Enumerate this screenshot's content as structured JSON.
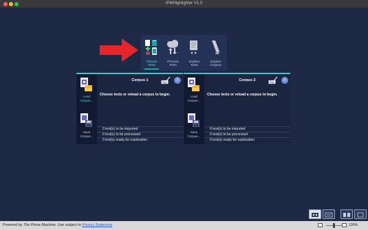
{
  "window": {
    "title": "tPMHighlighter V1.0"
  },
  "toolbar": {
    "items": [
      {
        "label_l1": "Choose",
        "label_l2": "Texts",
        "icon": "choose-texts-icon",
        "active": true
      },
      {
        "label_l1": "Process",
        "label_l2": "Texts",
        "icon": "process-texts-icon",
        "active": false
      },
      {
        "label_l1": "Explore",
        "label_l2": "Texts",
        "icon": "explore-texts-icon",
        "active": false
      },
      {
        "label_l1": "Explore",
        "label_l2": "Corpora",
        "icon": "explore-corpora-icon",
        "active": false
      }
    ]
  },
  "corpora": [
    {
      "title": "Corpus 1",
      "prompt": "Choose texts or reload a corpus to begin.",
      "load_l1": "Load",
      "load_l2": "Corpus...",
      "save_l1": "Save",
      "save_l2": "Corpus...",
      "stats": [
        "0 text(s) to be imported",
        "0 text(s) to be processed",
        "0 text(s) ready for exploration"
      ]
    },
    {
      "title": "Corpus 2",
      "prompt": "Choose texts or reload a corpus to begin.",
      "load_l1": "Load",
      "load_l2": "Corpus...",
      "save_l1": "Save",
      "save_l2": "Corpus...",
      "stats": [
        "0 text(s) to be imported",
        "0 text(s) to be processed",
        "0 text(s) ready for exploration"
      ]
    }
  ],
  "status": {
    "prefix": "Powered by ",
    "brand": "The Prime Machine",
    "middle": ". Use subject to ",
    "link": "Privacy Statement",
    "zoom": "100%"
  },
  "colors": {
    "accent": "#46c7cf",
    "background": "#1e2a45",
    "arrow": "#e8262a"
  }
}
